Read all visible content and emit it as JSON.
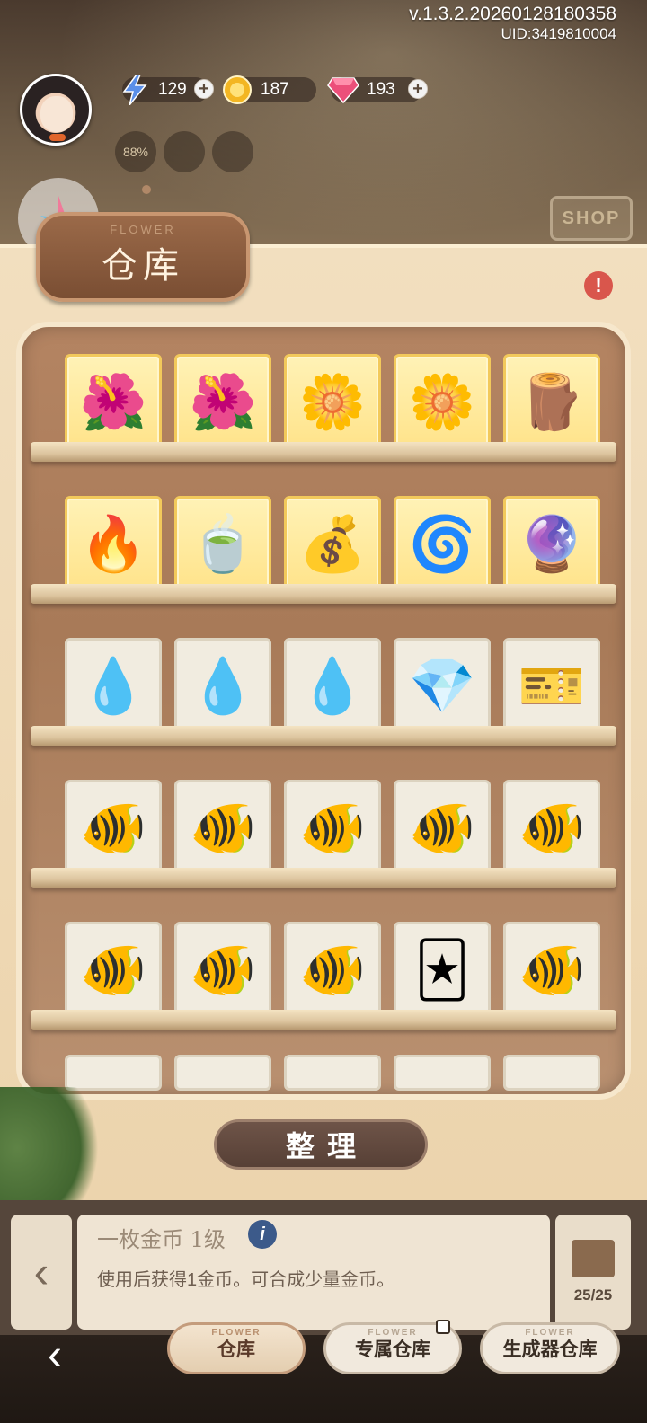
{
  "header": {
    "version": "v.1.3.2.20260128180358",
    "uid": "UID:3419810004",
    "resources": [
      {
        "icon": "lightning-icon",
        "value": "129"
      },
      {
        "icon": "gold-coin-icon",
        "value": "187"
      },
      {
        "icon": "pink-gem-icon",
        "value": "193"
      }
    ],
    "progress_badge": "88%",
    "shop_label": "SHOP"
  },
  "panel": {
    "title_en": "FLOWER",
    "title": "仓库",
    "alert": "!"
  },
  "shelves": [
    {
      "style": "gold",
      "items": [
        {
          "name": "orange-trumpet-flower",
          "glyph": "🌺"
        },
        {
          "name": "orange-trumpet-flower",
          "glyph": "🌺"
        },
        {
          "name": "yellow-lily-flower",
          "glyph": "🌼"
        },
        {
          "name": "yellow-blossoms",
          "glyph": "🌼"
        },
        {
          "name": "tree-stump-pot",
          "glyph": "🪵"
        }
      ]
    },
    {
      "style": "gold",
      "items": [
        {
          "name": "campfire",
          "glyph": "🔥"
        },
        {
          "name": "cat-teacup",
          "glyph": "🍵"
        },
        {
          "name": "cloth-sack",
          "glyph": "💰"
        },
        {
          "name": "green-vortex",
          "glyph": "🌀"
        },
        {
          "name": "galaxy-orb",
          "glyph": "🔮"
        }
      ]
    },
    {
      "style": "plain",
      "items": [
        {
          "name": "purple-water-drop",
          "glyph": "💧"
        },
        {
          "name": "blue-water-drop",
          "glyph": "💧"
        },
        {
          "name": "green-water-drop",
          "glyph": "💧"
        },
        {
          "name": "pink-gem",
          "glyph": "💎"
        },
        {
          "name": "ticket-card",
          "glyph": "🎫"
        }
      ]
    },
    {
      "style": "plain",
      "items": [
        {
          "name": "goldfish",
          "glyph": "🐠"
        },
        {
          "name": "goldfish",
          "glyph": "🐠"
        },
        {
          "name": "goldfish",
          "glyph": "🐠"
        },
        {
          "name": "goldfish",
          "glyph": "🐠"
        },
        {
          "name": "goldfish",
          "glyph": "🐠"
        }
      ]
    },
    {
      "style": "plain",
      "items": [
        {
          "name": "goldfish",
          "glyph": "🐠"
        },
        {
          "name": "goldfish",
          "glyph": "🐠"
        },
        {
          "name": "goldfish",
          "glyph": "🐠"
        },
        {
          "name": "d-card-deck",
          "glyph": "🃏"
        },
        {
          "name": "goldfish",
          "glyph": "🐠"
        }
      ]
    }
  ],
  "sort_button": "整理",
  "info": {
    "item_name": "一枚金币 1级",
    "description": "使用后获得1金币。可合成少量金币。",
    "capacity": "25/25"
  },
  "nav": {
    "tabs": [
      {
        "label": "仓库",
        "sub": "FLOWER",
        "active": true
      },
      {
        "label": "专属仓库",
        "sub": "FLOWER",
        "active": false,
        "locked": true
      },
      {
        "label": "生成器仓库",
        "sub": "FLOWER",
        "active": false
      }
    ]
  }
}
